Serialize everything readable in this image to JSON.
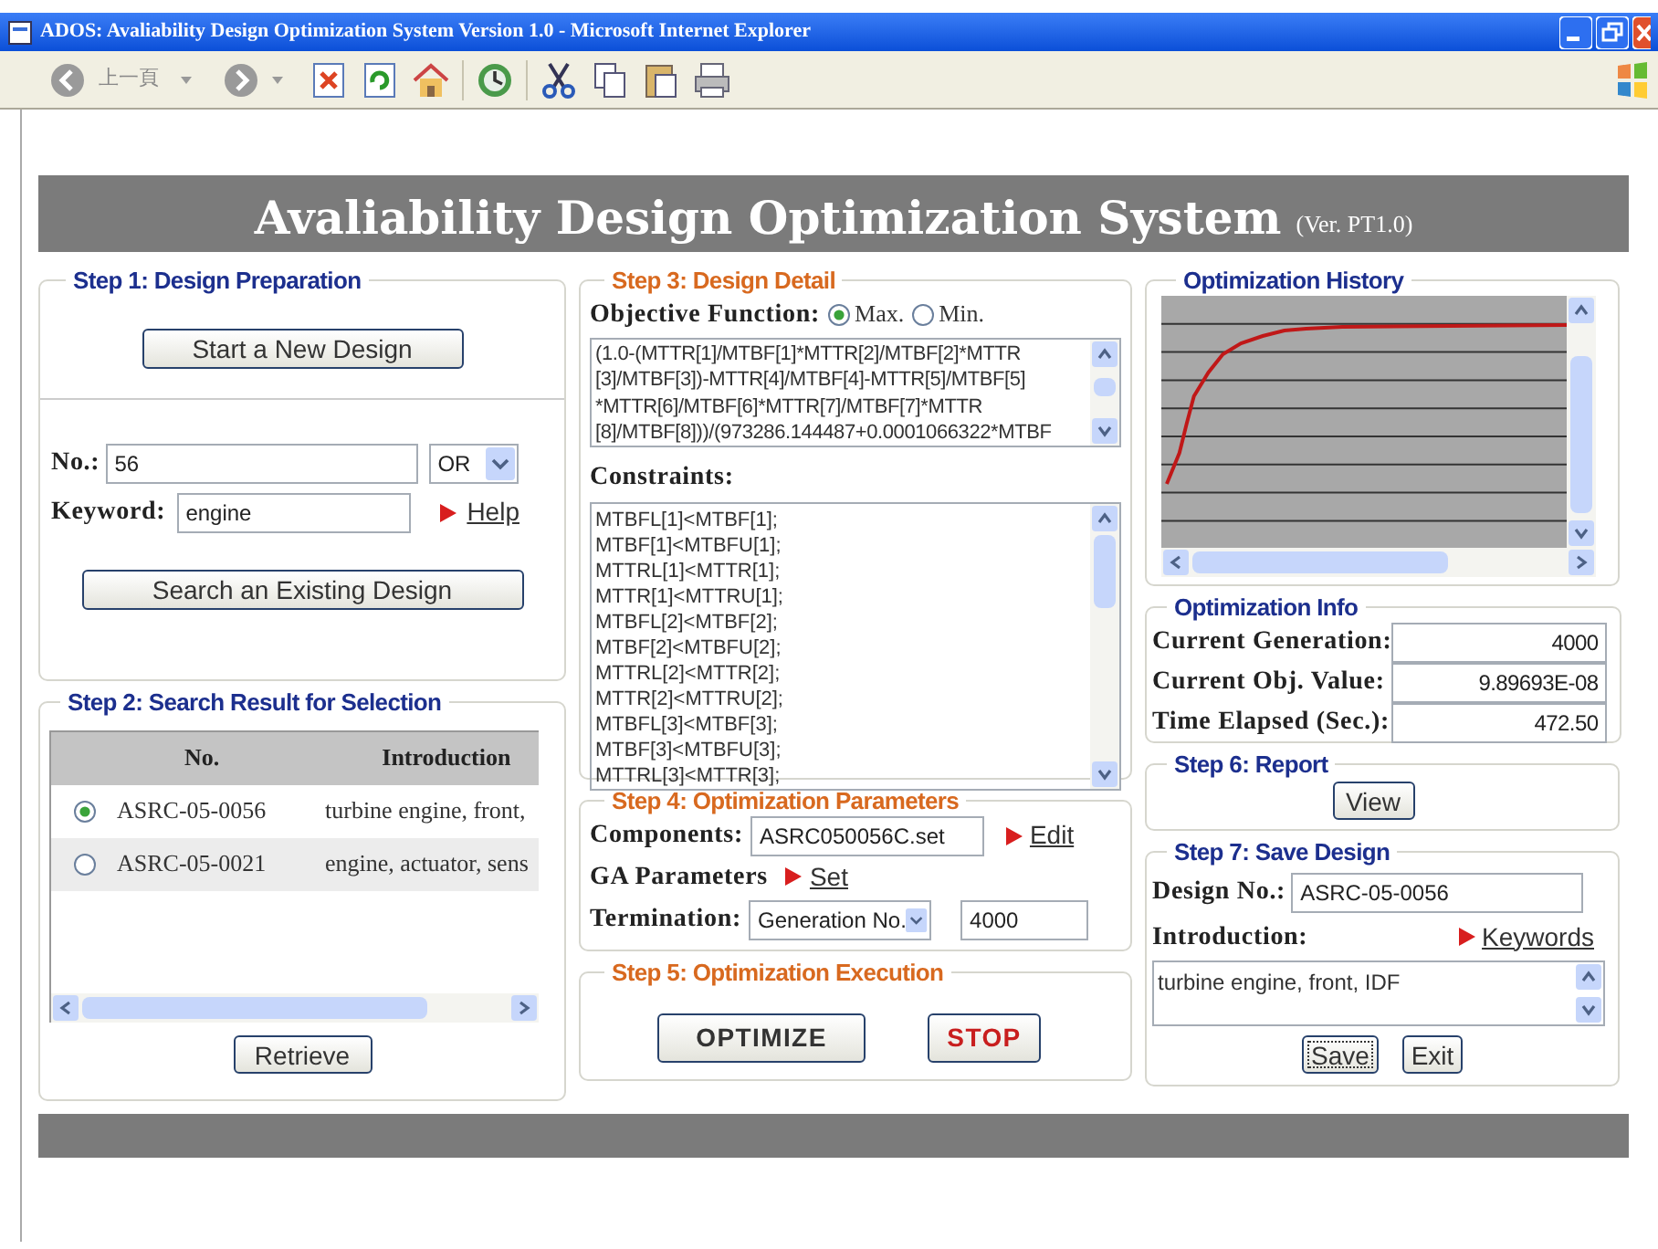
{
  "window": {
    "title": "ADOS: Avaliability Design Optimization System Version 1.0 - Microsoft Internet Explorer"
  },
  "toolbar": {
    "back_label": "上一頁"
  },
  "banner": {
    "title": "Avaliability Design Optimization System",
    "version": "(Ver. PT1.0)"
  },
  "step1": {
    "legend": "Step 1: Design Preparation",
    "new_button": "Start a New Design",
    "no_label": "No.:",
    "no_value": "56",
    "operator": "OR",
    "keyword_label": "Keyword:",
    "keyword_value": "engine",
    "help_link": "Help",
    "search_button": "Search an Existing Design"
  },
  "step2": {
    "legend": "Step 2: Search Result for Selection",
    "columns": [
      "No.",
      "Introduction"
    ],
    "rows": [
      {
        "no": "ASRC-05-0056",
        "introduction": "turbine engine, front,",
        "selected": true
      },
      {
        "no": "ASRC-05-0021",
        "introduction": "engine, actuator, sens",
        "selected": false
      }
    ],
    "retrieve_button": "Retrieve"
  },
  "step3": {
    "legend": "Step 3: Design Detail",
    "objective_label": "Objective Function:",
    "options": [
      {
        "label": "Max.",
        "selected": true
      },
      {
        "label": "Min.",
        "selected": false
      }
    ],
    "objective_lines": [
      "(1.0-(MTTR[1]/MTBF[1]*MTTR[2]/MTBF[2]*MTTR",
      "[3]/MTBF[3])-MTTR[4]/MTBF[4]-MTTR[5]/MTBF[5]",
      "*MTTR[6]/MTBF[6]*MTTR[7]/MTBF[7]*MTTR",
      "[8]/MTBF[8]))/(973286.144487+0.0001066322*MTBF"
    ],
    "constraints_label": "Constraints:",
    "constraints": [
      "MTBFL[1]<MTBF[1];",
      "MTBF[1]<MTBFU[1];",
      "MTTRL[1]<MTTR[1];",
      "MTTR[1]<MTTRU[1];",
      "MTBFL[2]<MTBF[2];",
      "MTBF[2]<MTBFU[2];",
      "MTTRL[2]<MTTR[2];",
      "MTTR[2]<MTTRU[2];",
      "MTBFL[3]<MTBF[3];",
      "MTBF[3]<MTBFU[3];",
      "MTTRL[3]<MTTR[3];"
    ]
  },
  "step4": {
    "legend": "Step 4: Optimization Parameters",
    "components_label": "Components:",
    "components_value": "ASRC050056C.set",
    "edit_link": "Edit",
    "ga_label": "GA Parameters",
    "set_link": "Set",
    "termination_label": "Termination:",
    "termination_option": "Generation No.",
    "termination_value": "4000"
  },
  "step5": {
    "legend": "Step 5: Optimization Execution",
    "optimize_button": "OPTIMIZE",
    "stop_button": "STOP"
  },
  "history": {
    "legend": "Optimization History"
  },
  "info": {
    "legend": "Optimization Info",
    "fields": [
      {
        "label": "Current Generation:",
        "value": "4000"
      },
      {
        "label": "Current Obj. Value:",
        "value": "9.89693E-08"
      },
      {
        "label": "Time Elapsed (Sec.):",
        "value": "472.50"
      }
    ]
  },
  "step6": {
    "legend": "Step 6: Report",
    "view_button": "View"
  },
  "step7": {
    "legend": "Step 7: Save Design",
    "design_no_label": "Design No.:",
    "design_no_value": "ASRC-05-0056",
    "introduction_label": "Introduction:",
    "keywords_link": "Keywords",
    "introduction_value": "turbine engine, front, IDF",
    "save_button": "Save",
    "exit_button": "Exit"
  }
}
